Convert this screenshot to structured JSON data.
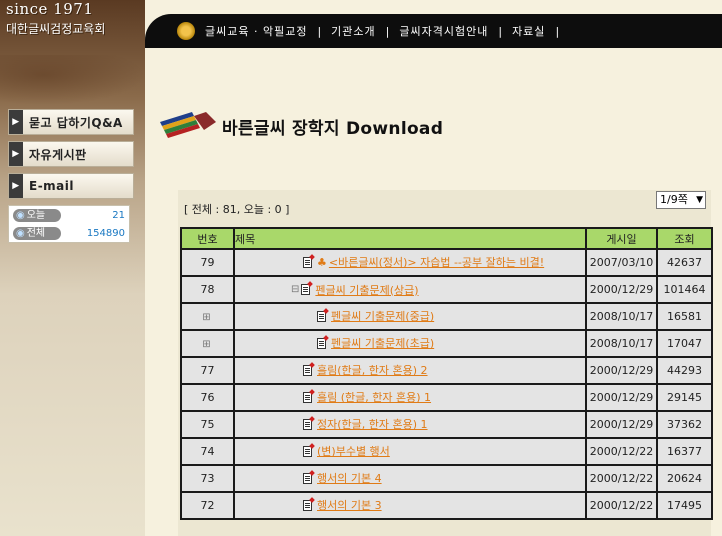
{
  "brand": {
    "since": "since 1971",
    "org": "대한글씨검정교육회"
  },
  "sidebar": {
    "items": [
      {
        "label": "묻고 답하기Q&A"
      },
      {
        "label": "자유게시판"
      },
      {
        "label": "E-mail"
      }
    ],
    "stats": {
      "today_label": "오늘",
      "today_value": "21",
      "total_label": "전체",
      "total_value": "154890"
    }
  },
  "nav": {
    "items": [
      {
        "label": "글씨교육 · 악필교정"
      },
      {
        "label": "기관소개"
      },
      {
        "label": "글씨자격시험안내"
      },
      {
        "label": "자료실"
      }
    ]
  },
  "page": {
    "title": "바른글씨 장학지 Download"
  },
  "board": {
    "summary": "[ 전체 : 81, 오늘 : 0 ]",
    "pager_value": "1/9쪽",
    "columns": [
      "번호",
      "제목",
      "게시일",
      "조회"
    ],
    "rows": [
      {
        "no": "79",
        "title": "<바른글씨(정서)> 자습법 --공부 잘하는 비결!",
        "date": "2007/03/10",
        "hits": "42637"
      },
      {
        "no": "78",
        "title": "펜글씨 기출문제(상급)",
        "date": "2000/12/29",
        "hits": "101464"
      },
      {
        "no": "",
        "title": "펜글씨 기출문제(중급)",
        "date": "2008/10/17",
        "hits": "16581"
      },
      {
        "no": "",
        "title": "펜글씨 기출문제(초급)",
        "date": "2008/10/17",
        "hits": "17047"
      },
      {
        "no": "77",
        "title": "흘림(한글, 한자 혼용) 2",
        "date": "2000/12/29",
        "hits": "44293"
      },
      {
        "no": "76",
        "title": "흘림 (한글, 한자 혼용) 1",
        "date": "2000/12/29",
        "hits": "29145"
      },
      {
        "no": "75",
        "title": "정자(한글, 한자 혼용) 1",
        "date": "2000/12/29",
        "hits": "37362"
      },
      {
        "no": "74",
        "title": "(변)부수별 행서",
        "date": "2000/12/22",
        "hits": "16377"
      },
      {
        "no": "73",
        "title": "행서의 기본 4",
        "date": "2000/12/22",
        "hits": "20624"
      },
      {
        "no": "72",
        "title": "행서의 기본 3",
        "date": "2000/12/22",
        "hits": "17495"
      }
    ]
  }
}
